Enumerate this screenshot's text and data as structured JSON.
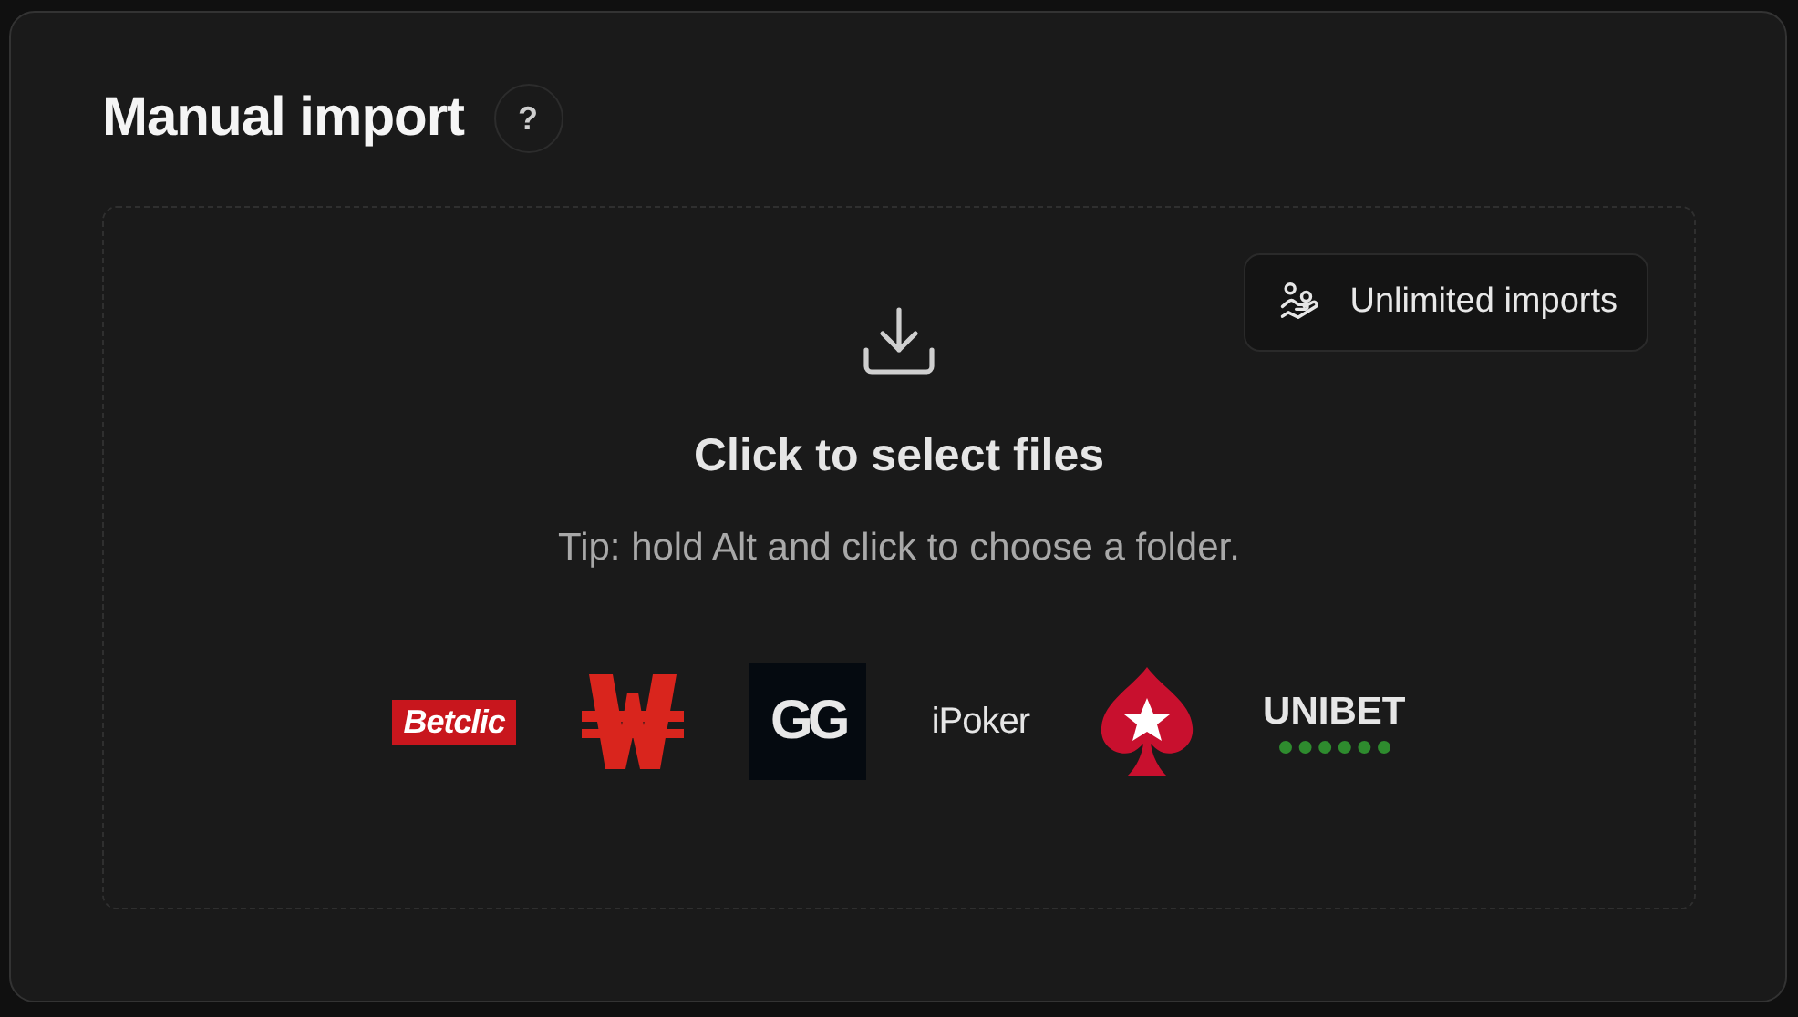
{
  "panel": {
    "title": "Manual import",
    "help": "?"
  },
  "dropzone": {
    "badge": "Unlimited imports",
    "heading": "Click to select files",
    "tip": "Tip: hold Alt and click to choose a folder."
  },
  "logos": [
    {
      "kind": "betclic",
      "text": "Betclic"
    },
    {
      "kind": "winamax"
    },
    {
      "kind": "gg",
      "text": "GG"
    },
    {
      "kind": "ipoker",
      "text": "iPoker"
    },
    {
      "kind": "pokerstars"
    },
    {
      "kind": "unibet",
      "text": "UNIBET"
    }
  ]
}
